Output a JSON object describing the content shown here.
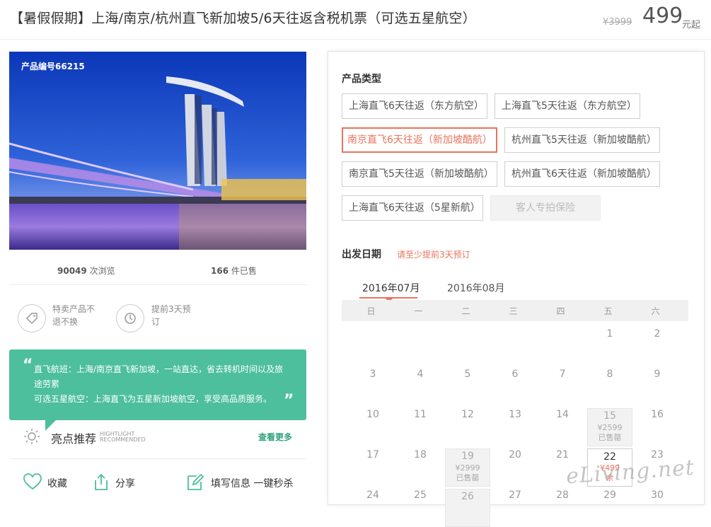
{
  "header": {
    "title": "【暑假假期】上海/南京/杭州直飞新加坡5/6天往返含税机票（可选五星航空）",
    "old_price": "¥3999",
    "price": "499",
    "price_unit": "元起"
  },
  "hero": {
    "product_no": "产品编号66215"
  },
  "stats": {
    "views_num": "90049",
    "views_label": " 次浏览",
    "sold_num": "166",
    "sold_label": " 件已售"
  },
  "features": [
    {
      "icon": "tag-icon",
      "text1": "特卖产品不",
      "text2": "退不换"
    },
    {
      "icon": "clock-icon",
      "text1": "提前3天预",
      "text2": "订"
    }
  ],
  "highlight": {
    "line1": "直飞航班：上海/南京直飞新加坡，一站直达，省去转机时间以及旅途劳累",
    "line2": "可选五星航空：上海直飞为五星新加坡航空，享受高品质服务。",
    "title": "亮点推荐",
    "title_en1": "HIGHTLIGHT",
    "title_en2": "RECOMMENDED",
    "more": "查看更多"
  },
  "actions": {
    "favorite": "收藏",
    "share": "分享",
    "fill": "填写信息 一键秒杀"
  },
  "product_type": {
    "title": "产品类型",
    "options": [
      "上海直飞6天往返（东方航空）",
      "上海直飞5天往返（东方航空）",
      "南京直飞6天往返（新加坡酷航）",
      "杭州直飞5天往返（新加坡酷航）",
      "南京直飞5天往返（新加坡酷航）",
      "杭州直飞6天往返（新加坡酷航）",
      "上海直飞6天往返（5星新航）",
      "客人专拍保险"
    ],
    "selected": 2
  },
  "departure": {
    "title": "出发日期",
    "hint": "请至少提前3天预订",
    "months": [
      "2016年07月",
      "2016年08月"
    ],
    "active_month": 0,
    "weekdays": [
      "日",
      "一",
      "二",
      "三",
      "四",
      "五",
      "六"
    ],
    "days": {
      "d1": "1",
      "d2": "2",
      "d3": "3",
      "d4": "4",
      "d5": "5",
      "d6": "6",
      "d7": "7",
      "d8": "8",
      "d9": "9",
      "d10": "10",
      "d11": "11",
      "d12": "12",
      "d13": "13",
      "d14": "14",
      "d15": "15",
      "d16": "16",
      "d17": "17",
      "d18": "18",
      "d19": "19",
      "d20": "20",
      "d21": "21",
      "d22": "22",
      "d23": "23",
      "d24": "24",
      "d25": "25",
      "d26": "26",
      "d27": "27",
      "d28": "28",
      "d29": "29",
      "d30": "30"
    },
    "d15_price": "¥2599",
    "d15_status": "已售罄",
    "d19_price": "¥2999",
    "d19_status": "已售罄",
    "d22_price": "¥499",
    "d22_status": "余"
  },
  "watermark": "eLiving.net"
}
